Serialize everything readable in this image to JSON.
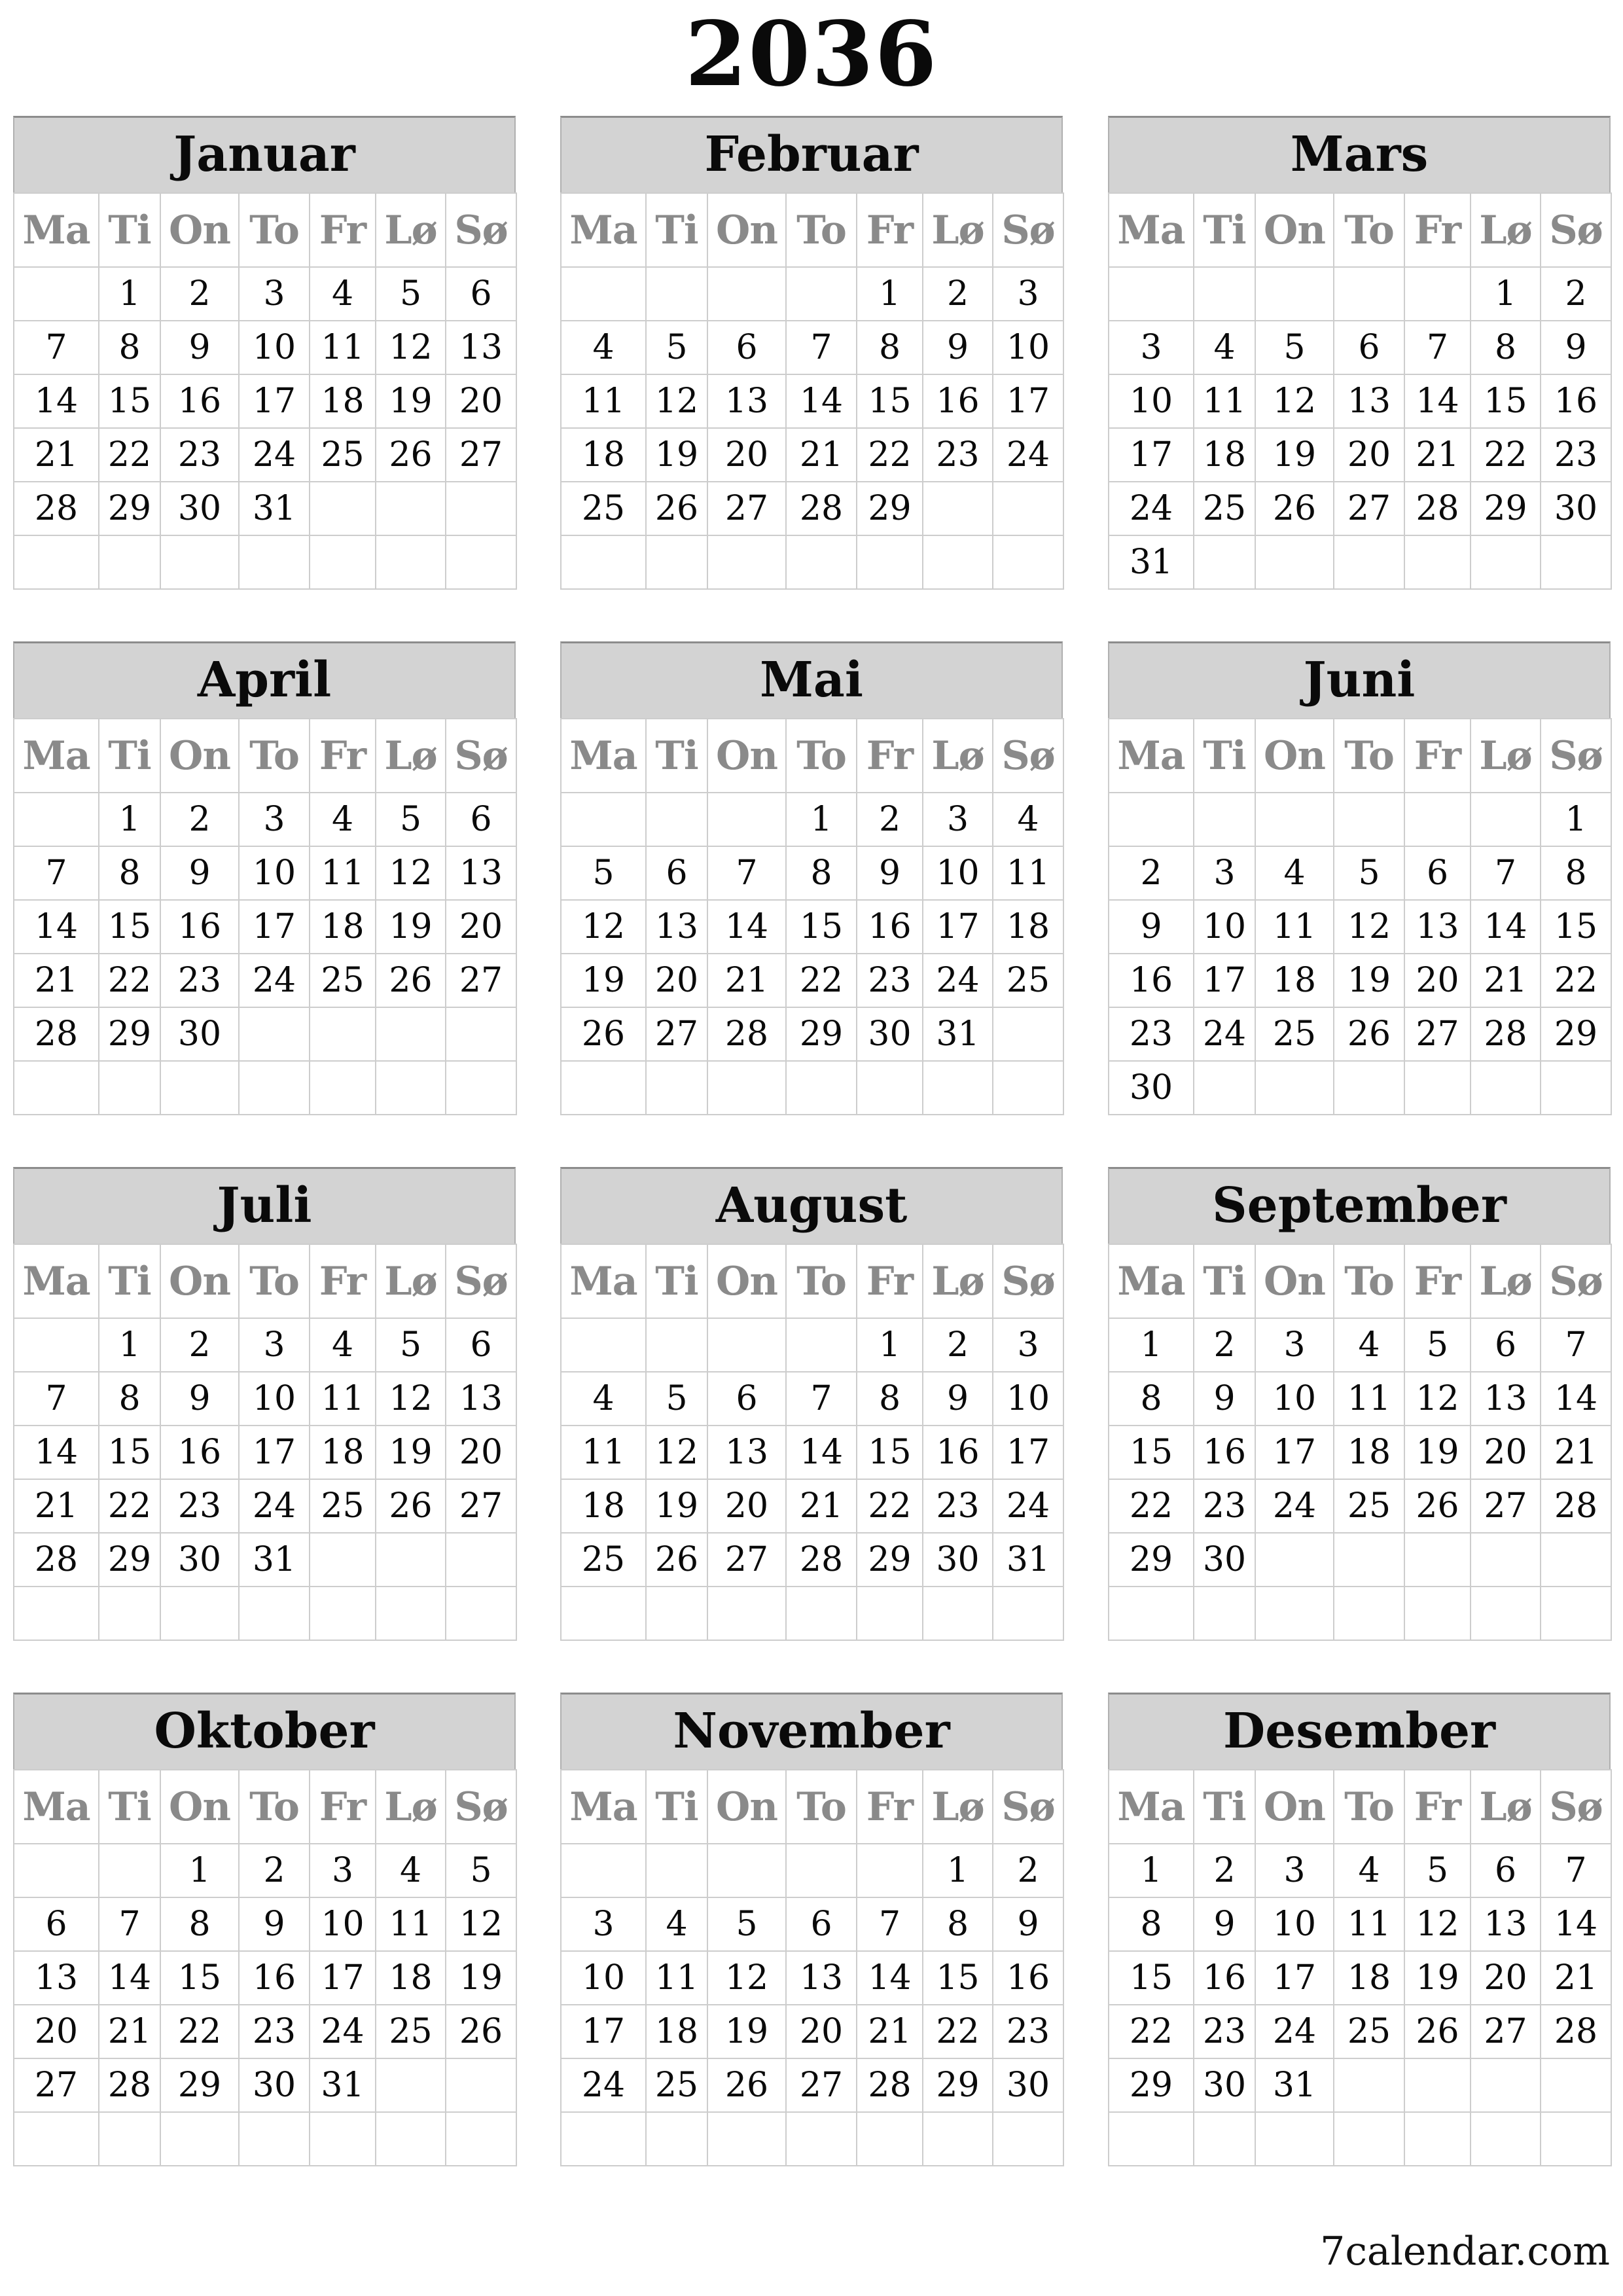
{
  "title": "2036",
  "weekday_labels": [
    "Ma",
    "Ti",
    "On",
    "To",
    "Fr",
    "Lø",
    "Sø"
  ],
  "months": [
    {
      "name": "Januar",
      "weeks": [
        [
          "",
          "1",
          "2",
          "3",
          "4",
          "5",
          "6"
        ],
        [
          "7",
          "8",
          "9",
          "10",
          "11",
          "12",
          "13"
        ],
        [
          "14",
          "15",
          "16",
          "17",
          "18",
          "19",
          "20"
        ],
        [
          "21",
          "22",
          "23",
          "24",
          "25",
          "26",
          "27"
        ],
        [
          "28",
          "29",
          "30",
          "31",
          "",
          "",
          ""
        ],
        [
          "",
          "",
          "",
          "",
          "",
          "",
          ""
        ]
      ]
    },
    {
      "name": "Februar",
      "weeks": [
        [
          "",
          "",
          "",
          "",
          "1",
          "2",
          "3"
        ],
        [
          "4",
          "5",
          "6",
          "7",
          "8",
          "9",
          "10"
        ],
        [
          "11",
          "12",
          "13",
          "14",
          "15",
          "16",
          "17"
        ],
        [
          "18",
          "19",
          "20",
          "21",
          "22",
          "23",
          "24"
        ],
        [
          "25",
          "26",
          "27",
          "28",
          "29",
          "",
          ""
        ],
        [
          "",
          "",
          "",
          "",
          "",
          "",
          ""
        ]
      ]
    },
    {
      "name": "Mars",
      "weeks": [
        [
          "",
          "",
          "",
          "",
          "",
          "1",
          "2"
        ],
        [
          "3",
          "4",
          "5",
          "6",
          "7",
          "8",
          "9"
        ],
        [
          "10",
          "11",
          "12",
          "13",
          "14",
          "15",
          "16"
        ],
        [
          "17",
          "18",
          "19",
          "20",
          "21",
          "22",
          "23"
        ],
        [
          "24",
          "25",
          "26",
          "27",
          "28",
          "29",
          "30"
        ],
        [
          "31",
          "",
          "",
          "",
          "",
          "",
          ""
        ]
      ]
    },
    {
      "name": "April",
      "weeks": [
        [
          "",
          "1",
          "2",
          "3",
          "4",
          "5",
          "6"
        ],
        [
          "7",
          "8",
          "9",
          "10",
          "11",
          "12",
          "13"
        ],
        [
          "14",
          "15",
          "16",
          "17",
          "18",
          "19",
          "20"
        ],
        [
          "21",
          "22",
          "23",
          "24",
          "25",
          "26",
          "27"
        ],
        [
          "28",
          "29",
          "30",
          "",
          "",
          "",
          ""
        ],
        [
          "",
          "",
          "",
          "",
          "",
          "",
          ""
        ]
      ]
    },
    {
      "name": "Mai",
      "weeks": [
        [
          "",
          "",
          "",
          "1",
          "2",
          "3",
          "4"
        ],
        [
          "5",
          "6",
          "7",
          "8",
          "9",
          "10",
          "11"
        ],
        [
          "12",
          "13",
          "14",
          "15",
          "16",
          "17",
          "18"
        ],
        [
          "19",
          "20",
          "21",
          "22",
          "23",
          "24",
          "25"
        ],
        [
          "26",
          "27",
          "28",
          "29",
          "30",
          "31",
          ""
        ],
        [
          "",
          "",
          "",
          "",
          "",
          "",
          ""
        ]
      ]
    },
    {
      "name": "Juni",
      "weeks": [
        [
          "",
          "",
          "",
          "",
          "",
          "",
          "1"
        ],
        [
          "2",
          "3",
          "4",
          "5",
          "6",
          "7",
          "8"
        ],
        [
          "9",
          "10",
          "11",
          "12",
          "13",
          "14",
          "15"
        ],
        [
          "16",
          "17",
          "18",
          "19",
          "20",
          "21",
          "22"
        ],
        [
          "23",
          "24",
          "25",
          "26",
          "27",
          "28",
          "29"
        ],
        [
          "30",
          "",
          "",
          "",
          "",
          "",
          ""
        ]
      ]
    },
    {
      "name": "Juli",
      "weeks": [
        [
          "",
          "1",
          "2",
          "3",
          "4",
          "5",
          "6"
        ],
        [
          "7",
          "8",
          "9",
          "10",
          "11",
          "12",
          "13"
        ],
        [
          "14",
          "15",
          "16",
          "17",
          "18",
          "19",
          "20"
        ],
        [
          "21",
          "22",
          "23",
          "24",
          "25",
          "26",
          "27"
        ],
        [
          "28",
          "29",
          "30",
          "31",
          "",
          "",
          ""
        ],
        [
          "",
          "",
          "",
          "",
          "",
          "",
          ""
        ]
      ]
    },
    {
      "name": "August",
      "weeks": [
        [
          "",
          "",
          "",
          "",
          "1",
          "2",
          "3"
        ],
        [
          "4",
          "5",
          "6",
          "7",
          "8",
          "9",
          "10"
        ],
        [
          "11",
          "12",
          "13",
          "14",
          "15",
          "16",
          "17"
        ],
        [
          "18",
          "19",
          "20",
          "21",
          "22",
          "23",
          "24"
        ],
        [
          "25",
          "26",
          "27",
          "28",
          "29",
          "30",
          "31"
        ],
        [
          "",
          "",
          "",
          "",
          "",
          "",
          ""
        ]
      ]
    },
    {
      "name": "September",
      "weeks": [
        [
          "1",
          "2",
          "3",
          "4",
          "5",
          "6",
          "7"
        ],
        [
          "8",
          "9",
          "10",
          "11",
          "12",
          "13",
          "14"
        ],
        [
          "15",
          "16",
          "17",
          "18",
          "19",
          "20",
          "21"
        ],
        [
          "22",
          "23",
          "24",
          "25",
          "26",
          "27",
          "28"
        ],
        [
          "29",
          "30",
          "",
          "",
          "",
          "",
          ""
        ],
        [
          "",
          "",
          "",
          "",
          "",
          "",
          ""
        ]
      ]
    },
    {
      "name": "Oktober",
      "weeks": [
        [
          "",
          "",
          "1",
          "2",
          "3",
          "4",
          "5"
        ],
        [
          "6",
          "7",
          "8",
          "9",
          "10",
          "11",
          "12"
        ],
        [
          "13",
          "14",
          "15",
          "16",
          "17",
          "18",
          "19"
        ],
        [
          "20",
          "21",
          "22",
          "23",
          "24",
          "25",
          "26"
        ],
        [
          "27",
          "28",
          "29",
          "30",
          "31",
          "",
          ""
        ],
        [
          "",
          "",
          "",
          "",
          "",
          "",
          ""
        ]
      ]
    },
    {
      "name": "November",
      "weeks": [
        [
          "",
          "",
          "",
          "",
          "",
          "1",
          "2"
        ],
        [
          "3",
          "4",
          "5",
          "6",
          "7",
          "8",
          "9"
        ],
        [
          "10",
          "11",
          "12",
          "13",
          "14",
          "15",
          "16"
        ],
        [
          "17",
          "18",
          "19",
          "20",
          "21",
          "22",
          "23"
        ],
        [
          "24",
          "25",
          "26",
          "27",
          "28",
          "29",
          "30"
        ],
        [
          "",
          "",
          "",
          "",
          "",
          "",
          ""
        ]
      ]
    },
    {
      "name": "Desember",
      "weeks": [
        [
          "1",
          "2",
          "3",
          "4",
          "5",
          "6",
          "7"
        ],
        [
          "8",
          "9",
          "10",
          "11",
          "12",
          "13",
          "14"
        ],
        [
          "15",
          "16",
          "17",
          "18",
          "19",
          "20",
          "21"
        ],
        [
          "22",
          "23",
          "24",
          "25",
          "26",
          "27",
          "28"
        ],
        [
          "29",
          "30",
          "31",
          "",
          "",
          "",
          ""
        ],
        [
          "",
          "",
          "",
          "",
          "",
          "",
          ""
        ]
      ]
    }
  ],
  "footer": {
    "brand": "7calendar.com"
  }
}
